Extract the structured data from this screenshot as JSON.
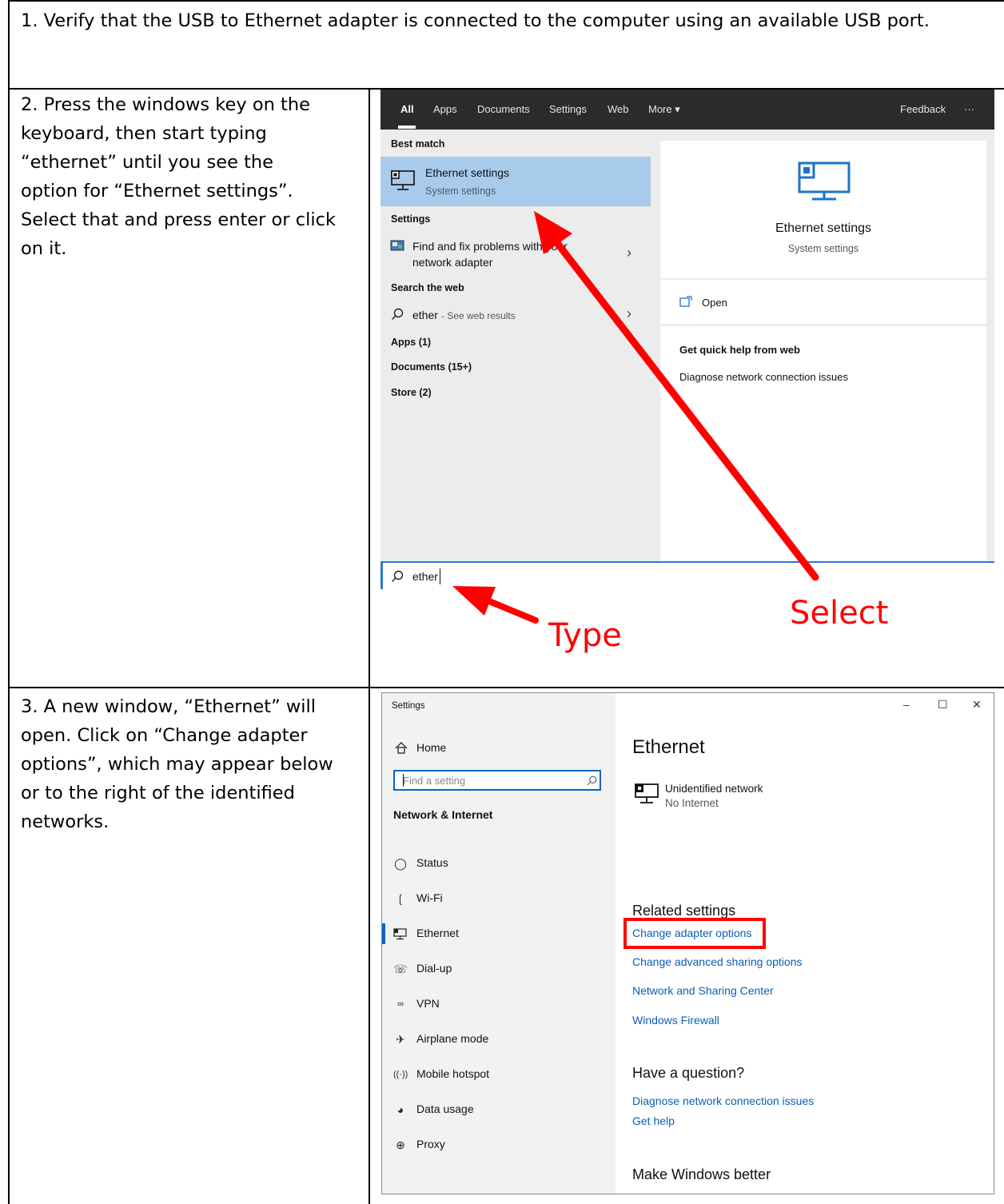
{
  "steps": [
    {
      "text": "1. Verify that the USB to Ethernet adapter is connected to the computer using an available USB port."
    },
    {
      "lines": [
        "2. Press the windows key on the",
        "keyboard, then start typing",
        "“ethernet” until you see the",
        "option for “Ethernet settings”.",
        "Select that and press enter or click",
        "on it."
      ]
    },
    {
      "lines": [
        "3. A new window, “Ethernet” will",
        "open. Click on “Change adapter",
        "options”, which may appear below",
        "or to the right of the identified",
        "networks."
      ]
    }
  ],
  "search_screenshot": {
    "tabs": [
      "All",
      "Apps",
      "Documents",
      "Settings",
      "Web",
      "More ▾"
    ],
    "feedback": "Feedback",
    "ellipsis": "···",
    "best_match_header": "Best match",
    "best_match_title": "Ethernet settings",
    "best_match_sub": "System settings",
    "settings_header": "Settings",
    "settings_item_line1": "Find and fix problems with your",
    "settings_item_line2": "network adapter",
    "web_header": "Search the web",
    "web_query": "ether",
    "web_suffix": " - See web results",
    "apps": "Apps (1)",
    "documents": "Documents (15+)",
    "store": "Store (2)",
    "preview_title": "Ethernet settings",
    "preview_sub": "System settings",
    "open_label": "Open",
    "quick_help_header": "Get quick help from web",
    "quick_help_item": "Diagnose network connection issues",
    "search_box_text": "ether"
  },
  "annotations": {
    "type": "Type",
    "select": "Select",
    "color": "#ff0000"
  },
  "settings_screenshot": {
    "window_title": "Settings",
    "minimize": "–",
    "maximize": "☐",
    "close": "✕",
    "home": "Home",
    "search_placeholder": "Find a setting",
    "section": "Network & Internet",
    "nav": [
      {
        "label": "Status",
        "icon": "globe-icon"
      },
      {
        "label": "Wi-Fi",
        "icon": "wifi-icon"
      },
      {
        "label": "Ethernet",
        "icon": "ethernet-icon"
      },
      {
        "label": "Dial-up",
        "icon": "dialup-icon"
      },
      {
        "label": "VPN",
        "icon": "vpn-icon"
      },
      {
        "label": "Airplane mode",
        "icon": "airplane-icon"
      },
      {
        "label": "Mobile hotspot",
        "icon": "hotspot-icon"
      },
      {
        "label": "Data usage",
        "icon": "data-usage-icon"
      },
      {
        "label": "Proxy",
        "icon": "proxy-icon"
      }
    ],
    "page_title": "Ethernet",
    "network_name": "Unidentified network",
    "network_status": "No Internet",
    "related_header": "Related settings",
    "related_links": [
      "Change adapter options",
      "Change advanced sharing options",
      "Network and Sharing Center",
      "Windows Firewall"
    ],
    "question_header": "Have a question?",
    "question_links": [
      "Diagnose network connection issues",
      "Get help"
    ],
    "better_header": "Make Windows better",
    "accent_color": "#0067c0",
    "highlight_color": "#ff0000"
  }
}
